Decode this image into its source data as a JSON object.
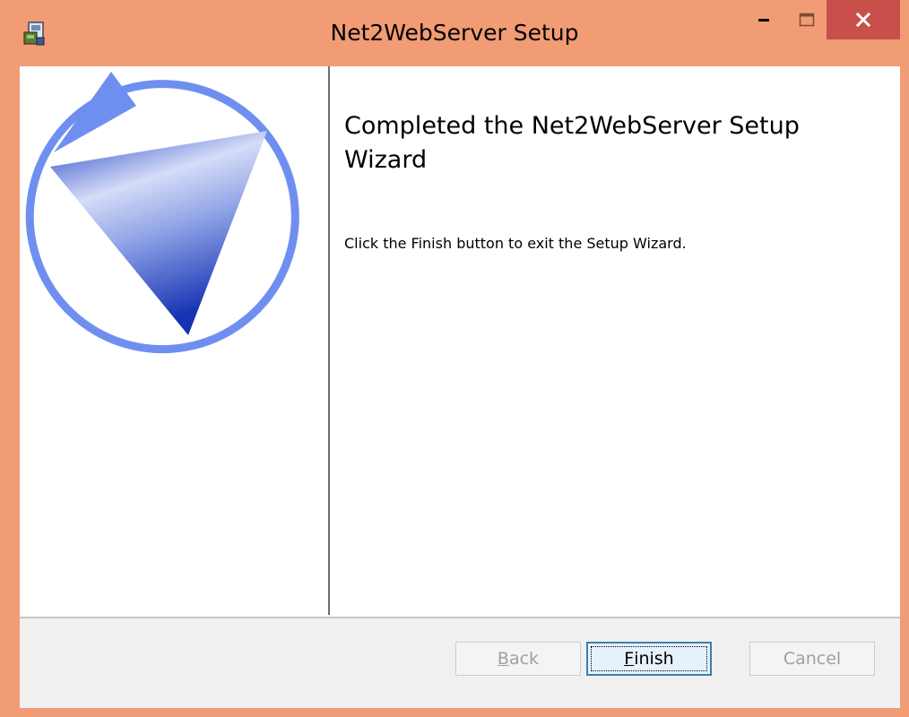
{
  "window": {
    "title": "Net2WebServer Setup",
    "frame_color": "#f19c74",
    "close_color": "#c7504b"
  },
  "icons": {
    "app": "installer-icon",
    "minimize": "minimize-icon",
    "maximize": "maximize-icon",
    "close": "close-icon",
    "graphic": "setup-wizard-logo"
  },
  "content": {
    "heading": "Completed the Net2WebServer Setup Wizard",
    "message": "Click the Finish button to exit the Setup Wizard."
  },
  "buttons": {
    "back": {
      "label": "Back",
      "mnemonic": "B",
      "rest": "ack",
      "enabled": false
    },
    "finish": {
      "label": "Finish",
      "mnemonic": "F",
      "rest": "inish",
      "enabled": true,
      "focused": true
    },
    "cancel": {
      "label": "Cancel",
      "enabled": false
    }
  }
}
